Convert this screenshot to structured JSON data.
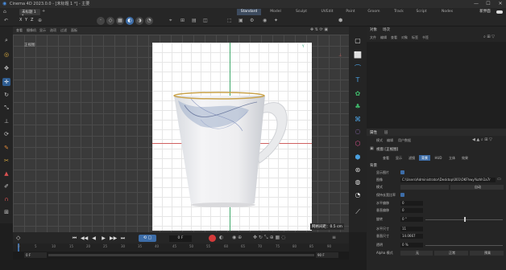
{
  "titlebar": {
    "title": "Cinema 4D 2023.0.0 - [未标题 1 *] - 主要",
    "minimize": "—",
    "maximize": "☐",
    "close": "✕"
  },
  "menubar": {
    "doc_tab": "未标题 1 *",
    "items": [
      "文件",
      "编辑",
      "创建",
      "模式",
      "选择",
      "工具",
      "样条",
      "网格",
      "体积",
      "运动图形",
      "角色",
      "动画",
      "模拟",
      "跟踪器",
      "渲染",
      "扩展",
      "窗口",
      "帮助"
    ],
    "layout_tabs": [
      "Standard",
      "Model",
      "Sculpt",
      "UVEdit",
      "Paint",
      "Groom",
      "Track",
      "Script",
      "Nodes"
    ],
    "new_layout": "新界面"
  },
  "toolbar": {
    "labels": [
      "X",
      "Y",
      "Z"
    ]
  },
  "viewport": {
    "menus": [
      "查看",
      "摄像机",
      "显示",
      "选项",
      "过滤",
      "面板"
    ],
    "view_name": "正视图",
    "scale_info": "网格间距：0.5 cm"
  },
  "objects_panel": {
    "tabs": [
      "对象",
      "场次"
    ],
    "menus": [
      "文件",
      "编辑",
      "查看",
      "对象",
      "标签",
      "书签"
    ]
  },
  "attributes_panel": {
    "tabs": [
      "属性",
      "层"
    ],
    "menus": [
      "模式",
      "编辑",
      "用户数据"
    ],
    "object_name": "视窗 [正视图]",
    "subtabs": [
      "查看",
      "显示",
      "滤镜",
      "背景",
      "HUD",
      "立体",
      "效果"
    ],
    "active_subtab": "背景",
    "section": "背景",
    "props": [
      {
        "label": "显示图片",
        "type": "check"
      },
      {
        "label": "图像",
        "value": "C:\\Users\\Administrator\\Desktop\\001\\OKFhwy%zhh1a7r"
      },
      {
        "label": "模式",
        "value": "",
        "value2": "自动"
      },
      {
        "label": "保持长宽比率",
        "type": "check"
      },
      {
        "label": "水平偏移",
        "value": "0"
      },
      {
        "label": "垂直偏移",
        "value": "0"
      },
      {
        "label": "旋转",
        "value": "0 °"
      },
      {
        "label": "水平尺寸",
        "value": "11"
      },
      {
        "label": "垂直尺寸",
        "value": "14.0667"
      },
      {
        "label": "透明",
        "value": "0 %"
      },
      {
        "label": "Alpha 模式",
        "value": "无",
        "value2": "正常",
        "value3": "预乘"
      }
    ]
  },
  "timeline": {
    "current_frame": "0 F",
    "start": "0 F",
    "end": "90 F",
    "end2": "90 F",
    "ticks": [
      "0",
      "5",
      "10",
      "15",
      "20",
      "25",
      "30",
      "35",
      "40",
      "45",
      "50",
      "55",
      "60",
      "65",
      "70",
      "75",
      "80",
      "85",
      "90"
    ],
    "playback": [
      "⏮",
      "◀◀",
      "◀",
      "▶",
      "▶▶",
      "⏭"
    ]
  },
  "colors": {
    "accent": "#3d6da8",
    "record": "#d43a3a"
  }
}
